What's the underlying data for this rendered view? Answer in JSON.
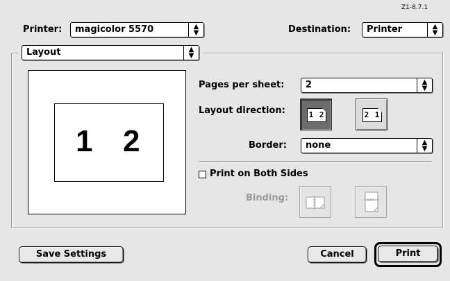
{
  "version": "Z1-8.7.1",
  "printer": {
    "label": "Printer:",
    "value": "magicolor 5570"
  },
  "destination": {
    "label": "Destination:",
    "value": "Printer"
  },
  "panel": {
    "value": "Layout"
  },
  "preview": {
    "page1": "1",
    "page2": "2"
  },
  "pages_per_sheet": {
    "label": "Pages per sheet:",
    "value": "2"
  },
  "layout_direction": {
    "label": "Layout direction:",
    "options": [
      {
        "text": "1 2",
        "selected": true,
        "icon": "left-to-right-layout-icon"
      },
      {
        "text": "2 1",
        "selected": false,
        "icon": "right-to-left-layout-icon"
      }
    ]
  },
  "border": {
    "label": "Border:",
    "value": "none"
  },
  "duplex": {
    "label": "Print on Both Sides",
    "checked": false
  },
  "binding": {
    "label": "Binding:",
    "options": [
      {
        "icon": "long-edge-binding-icon",
        "enabled": false
      },
      {
        "icon": "short-edge-binding-icon",
        "enabled": false
      }
    ]
  },
  "buttons": {
    "save": "Save Settings",
    "cancel": "Cancel",
    "print": "Print"
  }
}
